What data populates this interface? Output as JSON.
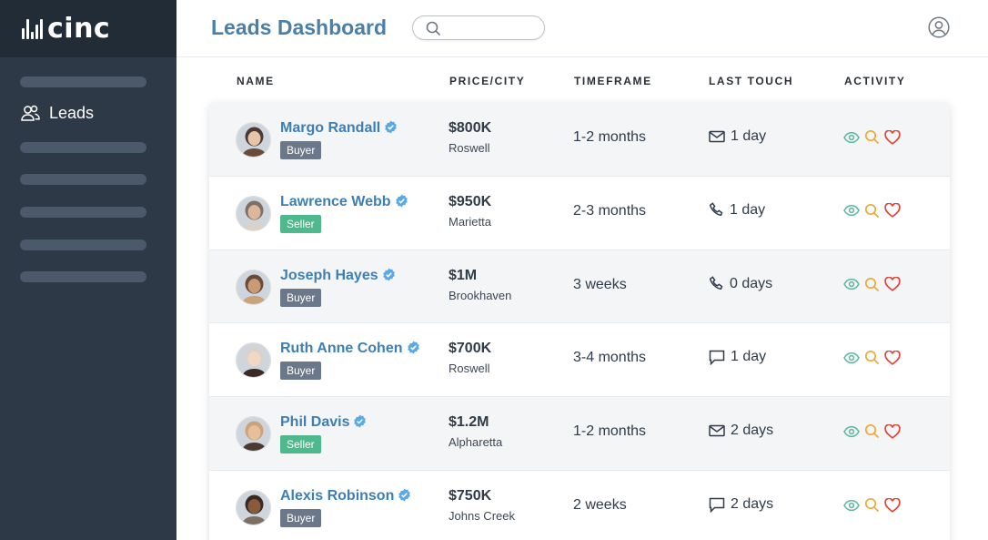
{
  "app": {
    "logo_text": "cinc"
  },
  "sidebar": {
    "nav_label": "Leads"
  },
  "header": {
    "title": "Leads Dashboard",
    "search_placeholder": "",
    "search_value": ""
  },
  "table": {
    "columns": [
      "NAME",
      "PRICE/CITY",
      "TIMEFRAME",
      "LAST TOUCH",
      "ACTIVITY"
    ],
    "rows": [
      {
        "name": "Margo Randall",
        "type": "Buyer",
        "price": "$800K",
        "city": "Roswell",
        "timeframe": "1-2 months",
        "touch_icon": "mail-icon",
        "touch": "1 day"
      },
      {
        "name": "Lawrence Webb",
        "type": "Seller",
        "price": "$950K",
        "city": "Marietta",
        "timeframe": "2-3 months",
        "touch_icon": "phone-icon",
        "touch": "1 day"
      },
      {
        "name": "Joseph Hayes",
        "type": "Buyer",
        "price": "$1M",
        "city": "Brookhaven",
        "timeframe": "3 weeks",
        "touch_icon": "phone-icon",
        "touch": "0 days"
      },
      {
        "name": "Ruth Anne Cohen",
        "type": "Buyer",
        "price": "$700K",
        "city": "Roswell",
        "timeframe": "3-4 months",
        "touch_icon": "chat-icon",
        "touch": "1 day"
      },
      {
        "name": "Phil Davis",
        "type": "Seller",
        "price": "$1.2M",
        "city": "Alpharetta",
        "timeframe": "1-2 months",
        "touch_icon": "mail-icon",
        "touch": "2 days"
      },
      {
        "name": "Alexis Robinson",
        "type": "Buyer",
        "price": "$750K",
        "city": "Johns Creek",
        "timeframe": "2 weeks",
        "touch_icon": "chat-icon",
        "touch": "2 days"
      }
    ]
  },
  "colors": {
    "sidebar_bg": "#2e3947",
    "title": "#4a7fa8",
    "lead_name": "#3d7fb5",
    "buyer_badge": "#6b7889",
    "seller_badge": "#4fb88d",
    "eye_icon": "#5cb89a",
    "search_icon": "#f0a830",
    "heart_icon": "#e0453a",
    "verified_icon": "#5aa9e6"
  }
}
